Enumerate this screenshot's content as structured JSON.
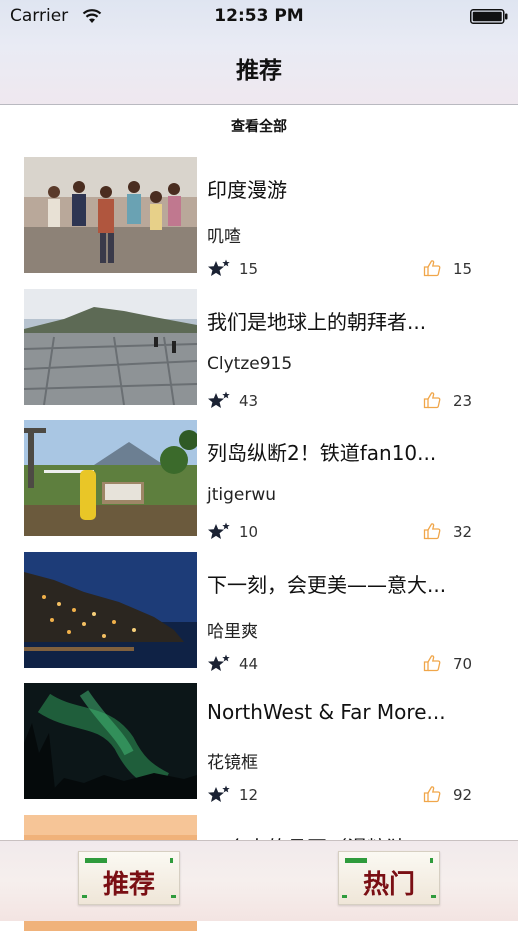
{
  "status_bar": {
    "carrier": "Carrier",
    "time": "12:53 PM"
  },
  "nav": {
    "title": "推荐"
  },
  "list_header": {
    "see_all": "查看全部"
  },
  "items": [
    {
      "title": "印度漫游",
      "author": "叽喳",
      "favorites": "15",
      "likes": "15"
    },
    {
      "title": "我们是地球上的朝拜者...",
      "author": "Clytze915",
      "favorites": "43",
      "likes": "23"
    },
    {
      "title": "列岛纵断2！铁道fan10...",
      "author": "jtigerwu",
      "favorites": "10",
      "likes": "32"
    },
    {
      "title": "下一刻，会更美——意大...",
      "author": "哈里爽",
      "favorites": "44",
      "likes": "70"
    },
    {
      "title": "NorthWest & Far More...",
      "author": "花镜框",
      "favorites": "12",
      "likes": "92"
    },
    {
      "title": "一个人的旦哥（漫粒独...",
      "author": "",
      "favorites": "",
      "likes": ""
    }
  ],
  "tabbar": {
    "tabs": [
      {
        "label": "推荐"
      },
      {
        "label": "热门"
      }
    ]
  },
  "icons": {
    "favorite": "star-icon",
    "like": "thumbs-up-icon",
    "wifi": "wifi-icon",
    "battery": "battery-icon"
  },
  "colors": {
    "like_icon": "#f0a64a",
    "star_icon": "#1b2233",
    "tab_label": "#7a0f14",
    "tab_accent": "#2f9b3c"
  }
}
